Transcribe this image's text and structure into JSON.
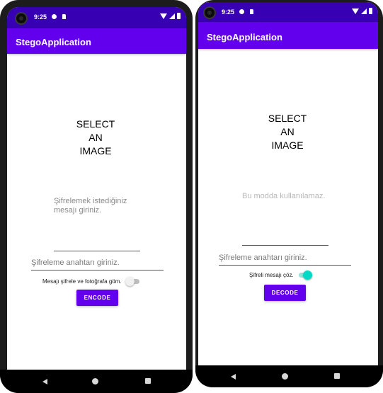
{
  "colors": {
    "status_bar": "#3700b3",
    "app_bar": "#6200ee",
    "button": "#6200ee",
    "switch_on": "#03dac5"
  },
  "encode_screen": {
    "status": {
      "time": "9:25"
    },
    "app_title": "StegoApplication",
    "select_image": "SELECT\nAN\nIMAGE",
    "message_field": {
      "placeholder": "Şifrelemek istediğiniz mesajı giriniz."
    },
    "key_field": {
      "placeholder": "Şifreleme anahtarı giriniz."
    },
    "mode_switch": {
      "label": "Mesajı şifrele ve fotoğrafa göm.",
      "checked": false
    },
    "action_button": "ENCODE"
  },
  "decode_screen": {
    "status": {
      "time": "9:25"
    },
    "app_title": "StegoApplication",
    "select_image": "SELECT\nAN\nIMAGE",
    "message_field": {
      "placeholder": "Bu modda kullanılamaz."
    },
    "key_field": {
      "placeholder": "Şifreleme anahtarı giriniz."
    },
    "mode_switch": {
      "label": "Şifreli mesajı çöz.",
      "checked": true
    },
    "action_button": "DECODE"
  },
  "nav_icons": [
    "back-icon",
    "home-icon",
    "recents-icon"
  ]
}
